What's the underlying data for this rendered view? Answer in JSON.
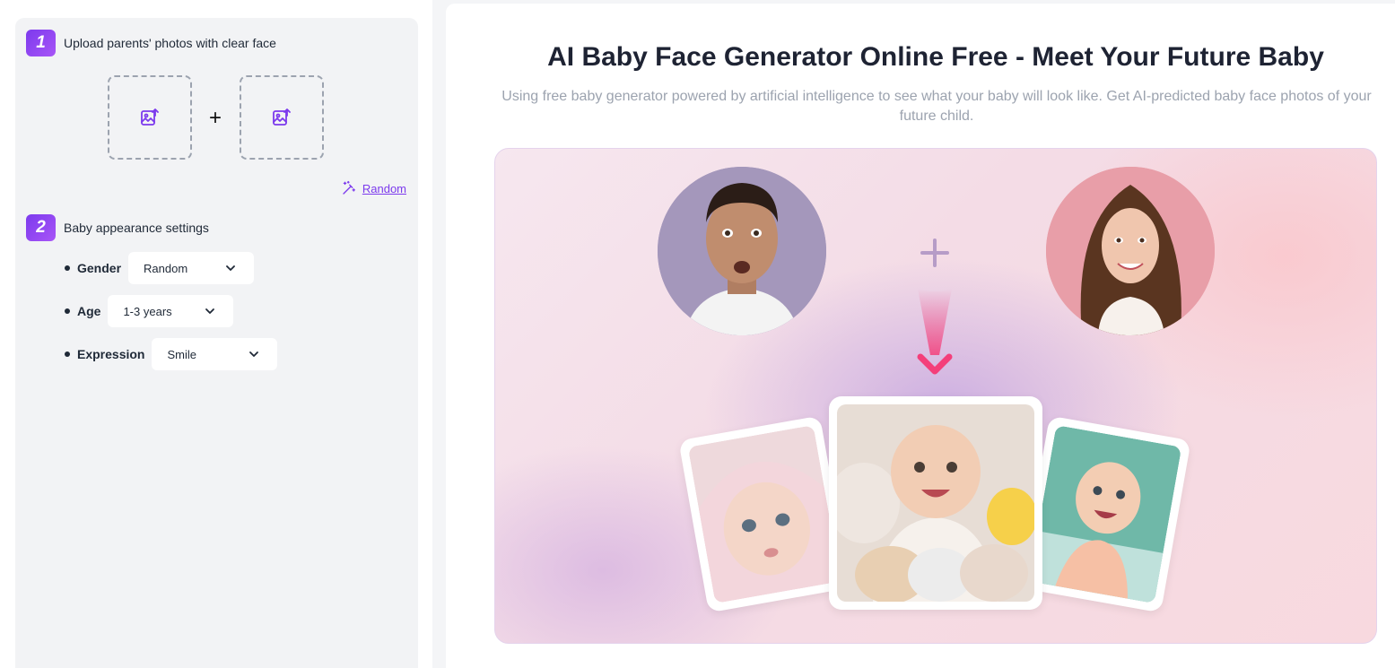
{
  "steps": {
    "upload": {
      "number": "1",
      "label": "Upload parents' photos with clear face"
    },
    "settings": {
      "number": "2",
      "label": "Baby appearance settings"
    }
  },
  "upload": {
    "icon": "image-upload-icon",
    "plus": "+",
    "random_label": "Random",
    "random_icon": "magic-wand-icon"
  },
  "settings": {
    "gender": {
      "label": "Gender",
      "value": "Random"
    },
    "age": {
      "label": "Age",
      "value": "1-3 years"
    },
    "expression": {
      "label": "Expression",
      "value": "Smile"
    }
  },
  "hero": {
    "title": "AI Baby Face Generator Online Free - Meet Your Future Baby",
    "subtitle": "Using free baby generator powered by artificial intelligence to see what your baby will look like. Get AI-predicted baby face photos of your future child."
  },
  "colors": {
    "accent": "#7c3aed",
    "arrow": "#f43f7a"
  }
}
